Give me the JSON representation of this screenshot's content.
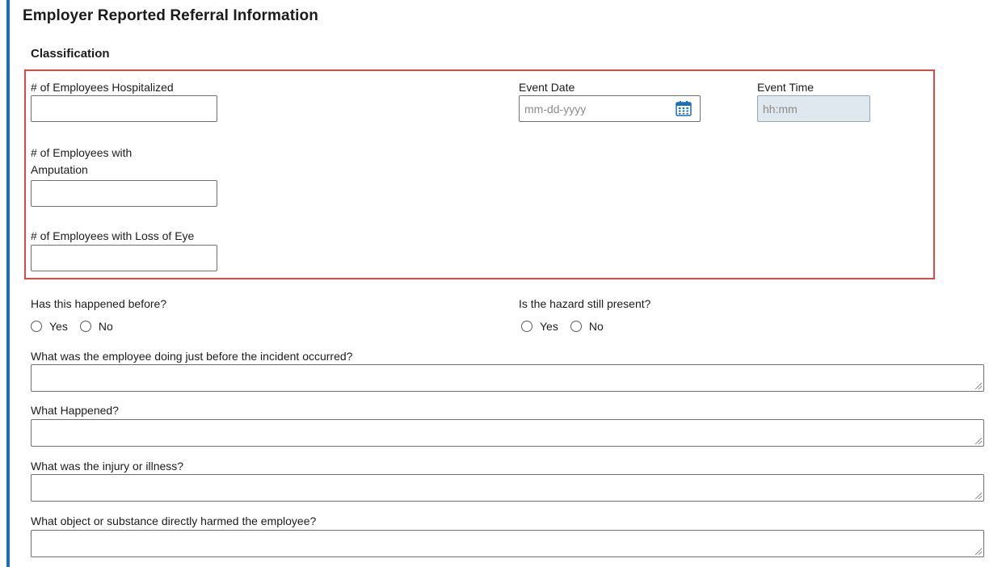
{
  "section": {
    "title": "Employer Reported Referral Information",
    "subtitle": "Classification"
  },
  "classification": {
    "hospitalized_label": "# of Employees Hospitalized",
    "hospitalized_value": "",
    "amputation_label_line1": "# of Employees with",
    "amputation_label_line2": "Amputation",
    "amputation_value": "",
    "loss_of_eye_label": "# of Employees with Loss of Eye",
    "loss_of_eye_value": "",
    "event_date_label": "Event Date",
    "event_date_placeholder": "mm-dd-yyyy",
    "event_date_icon": "calendar-icon",
    "event_time_label": "Event Time",
    "event_time_placeholder": "hh:mm"
  },
  "questions": {
    "happened_before": {
      "label": "Has this happened before?",
      "options": [
        "Yes",
        "No"
      ]
    },
    "hazard_present": {
      "label": "Is the hazard still present?",
      "options": [
        "Yes",
        "No"
      ]
    },
    "doing_before": {
      "label": "What was the employee doing just before the incident occurred?",
      "value": ""
    },
    "what_happened": {
      "label": "What Happened?",
      "value": ""
    },
    "injury_illness": {
      "label": "What was the injury or illness?",
      "value": ""
    },
    "object_substance": {
      "label": "What object or substance directly harmed the employee?",
      "value": ""
    }
  },
  "colors": {
    "accent_bar": "#1a6fb5",
    "highlight_border": "#e04848",
    "disabled_field": "#dfe8ef",
    "calendar_icon": "#1a6fb5"
  }
}
